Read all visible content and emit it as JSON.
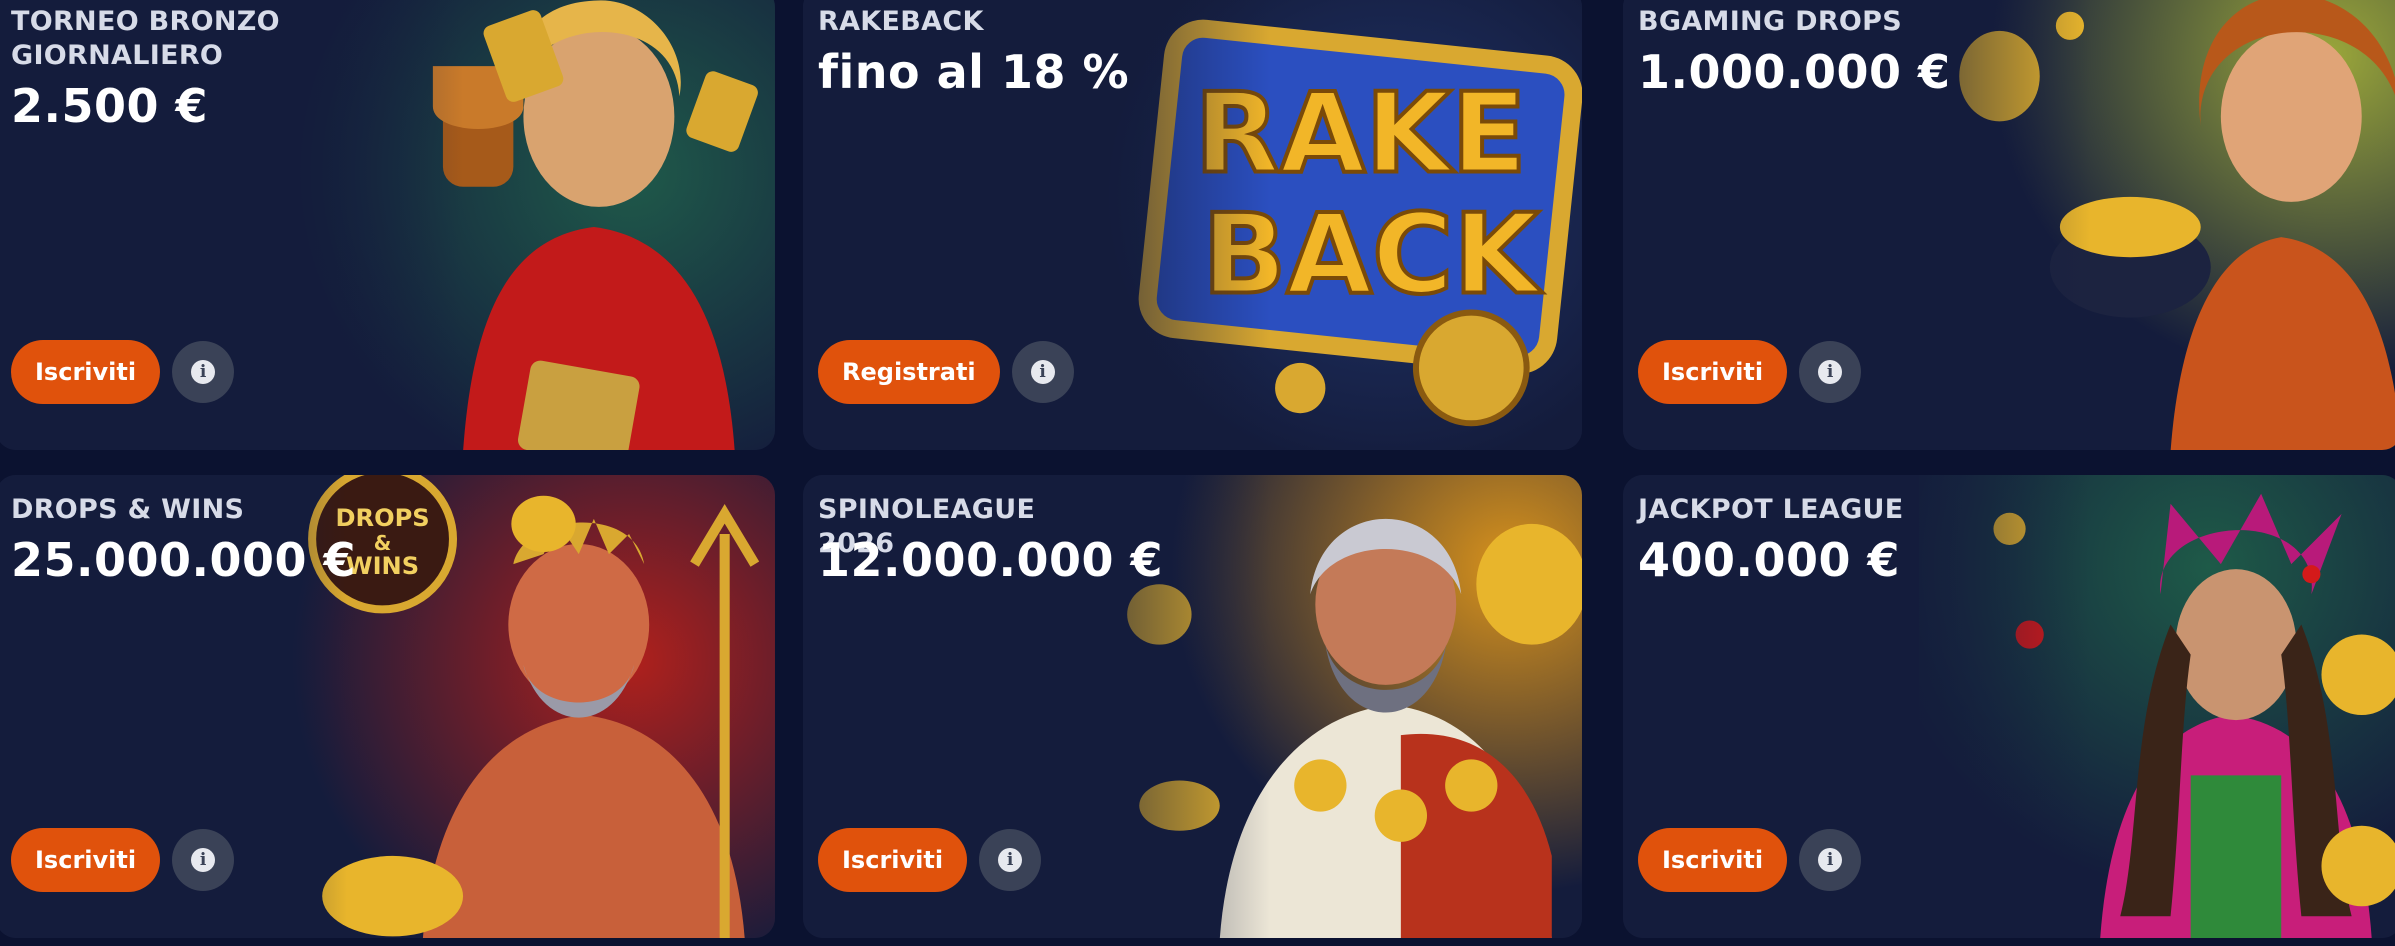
{
  "cards": [
    {
      "title": "TORNEO BRONZO\nGIORNALIERO",
      "amount": "2.500 €",
      "button": "Iscriviti",
      "info_icon": "info-icon",
      "art": "woman-with-trophy-illustration"
    },
    {
      "title": "RAKEBACK",
      "amount": "fino al 18 %",
      "button": "Registrati",
      "info_icon": "info-icon",
      "art": "rakeback-logo-illustration",
      "art_text_1": "RAKE",
      "art_text_2": "BACK"
    },
    {
      "title": "BGAMING DROPS",
      "amount": "1.000.000 €",
      "button": "Iscriviti",
      "info_icon": "info-icon",
      "art": "woman-with-gold-pot-illustration"
    },
    {
      "title": "DROPS & WINS",
      "amount": "25.000.000 €",
      "button": "Iscriviti",
      "info_icon": "info-icon",
      "art": "poseidon-illustration",
      "badge_line1": "DROPS",
      "badge_line2": "&",
      "badge_line3": "WINS"
    },
    {
      "title": "SPINOLEAGUE 2026",
      "amount": "12.000.000 €",
      "button": "Iscriviti",
      "info_icon": "info-icon",
      "art": "zeus-illustration"
    },
    {
      "title": "JACKPOT LEAGUE",
      "amount": "400.000 €",
      "button": "Iscriviti",
      "info_icon": "info-icon",
      "art": "jester-woman-illustration"
    }
  ],
  "colors": {
    "page_background": "#0b1230",
    "card_background": "#141c3c",
    "button": "#e0520c",
    "info_button": "#3a4257",
    "gold": "#f2b628"
  }
}
